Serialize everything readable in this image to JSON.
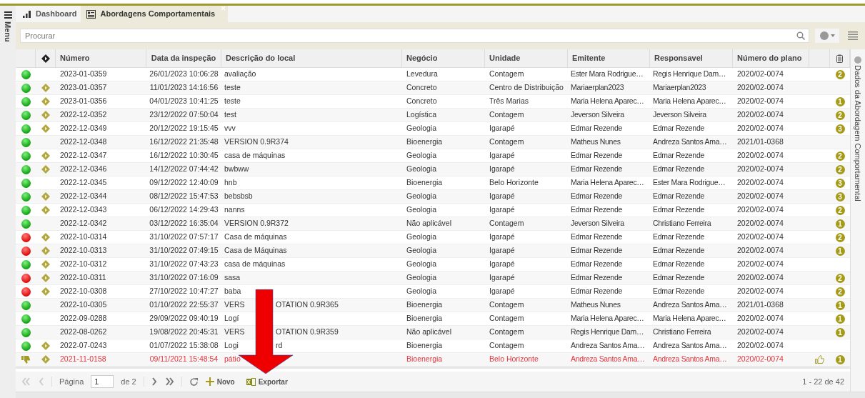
{
  "sidebar": {
    "label": "Menu"
  },
  "tabs": [
    {
      "label": "Dashboard",
      "selected": false
    },
    {
      "label": "Abordagens Comportamentais",
      "selected": true
    }
  ],
  "search": {
    "placeholder": "Procurar"
  },
  "table": {
    "columns": [
      "",
      "",
      "Número",
      "Data da inspeção",
      "Descrição do local",
      "Negócio",
      "Unidade",
      "Emitente",
      "Responsavel",
      "Número do plano",
      "",
      ""
    ],
    "rows": [
      {
        "kind": "ok",
        "flagged": false,
        "highlighted": false,
        "approved": false,
        "number": "2023-01-0359",
        "date": "26/01/2023 10:06:28",
        "description": [
          "avaliação"
        ],
        "business": "Levedura",
        "unit": "Contagem",
        "issuer": "Ester Mara Rodrigue…",
        "responsible": "Regis Henrique Dam…",
        "plan": "2020/02-0074",
        "badge": "2"
      },
      {
        "kind": "ok",
        "flagged": true,
        "highlighted": false,
        "approved": false,
        "number": "2023-01-0357",
        "date": "11/01/2023 14:16:56",
        "description": [
          "teste"
        ],
        "business": "Concreto",
        "unit": "Centro de Distribuição",
        "issuer": "Mariaerplan2023",
        "responsible": "Mariaerplan2023",
        "plan": "2020/02-0074"
      },
      {
        "kind": "ok",
        "flagged": true,
        "highlighted": false,
        "approved": false,
        "number": "2023-01-0356",
        "date": "04/01/2023 10:41:25",
        "description": [
          "teste"
        ],
        "business": "Concreto",
        "unit": "Três Marias",
        "issuer": "Maria Helena Aparec…",
        "responsible": "Maria Helena Aparec…",
        "plan": "2020/02-0074",
        "badge": "1"
      },
      {
        "kind": "ok",
        "flagged": true,
        "highlighted": false,
        "approved": false,
        "number": "2022-12-0352",
        "date": "23/12/2022 07:50:04",
        "description": [
          "test"
        ],
        "business": "Logística",
        "unit": "Contagem",
        "issuer": "Jeverson Silveira",
        "responsible": "Jeverson Silveira",
        "plan": "2020/02-0074",
        "badge": "2"
      },
      {
        "kind": "ok",
        "flagged": true,
        "highlighted": false,
        "approved": false,
        "number": "2022-12-0349",
        "date": "20/12/2022 19:15:45",
        "description": [
          "vvv"
        ],
        "business": "Geologia",
        "unit": "Igarapé",
        "issuer": "Edmar Rezende",
        "responsible": "Edmar Rezende",
        "plan": "2020/02-0074",
        "badge": "3"
      },
      {
        "kind": "ok",
        "flagged": false,
        "highlighted": false,
        "approved": false,
        "number": "2022-12-0348",
        "date": "16/12/2022 21:35:48",
        "description": [
          "VERSION 0.9R374"
        ],
        "business": "Bioenergia",
        "unit": "Contagem",
        "issuer": "Matheus Nunes",
        "responsible": "Andreza Santos Ama…",
        "plan": "2021/01-0368"
      },
      {
        "kind": "ok",
        "flagged": true,
        "highlighted": false,
        "approved": false,
        "number": "2022-12-0347",
        "date": "16/12/2022 10:30:45",
        "description": [
          "casa de máquinas"
        ],
        "business": "Geologia",
        "unit": "Igarapé",
        "issuer": "Edmar Rezende",
        "responsible": "Edmar Rezende",
        "plan": "2020/02-0074",
        "badge": "2"
      },
      {
        "kind": "ok",
        "flagged": true,
        "highlighted": false,
        "approved": false,
        "number": "2022-12-0346",
        "date": "14/12/2022 07:44:42",
        "description": [
          "bwbww"
        ],
        "business": "Geologia",
        "unit": "Igarapé",
        "issuer": "Edmar Rezende",
        "responsible": "Edmar Rezende",
        "plan": "2020/02-0074",
        "badge": "2"
      },
      {
        "kind": "ok",
        "flagged": false,
        "highlighted": false,
        "approved": false,
        "number": "2022-12-0345",
        "date": "09/12/2022 12:40:09",
        "description": [
          "hnb"
        ],
        "business": "Bioenergia",
        "unit": "Belo Horizonte",
        "issuer": "Maria Helena Aparec…",
        "responsible": "Ester Mara Rodrigue…",
        "plan": "2020/02-0074",
        "badge": "3"
      },
      {
        "kind": "ok",
        "flagged": true,
        "highlighted": false,
        "approved": false,
        "number": "2022-12-0344",
        "date": "08/12/2022 15:47:53",
        "description": [
          "bebsbsb"
        ],
        "business": "Geologia",
        "unit": "Igarapé",
        "issuer": "Edmar Rezende",
        "responsible": "Edmar Rezende",
        "plan": "2020/02-0074",
        "badge": "3"
      },
      {
        "kind": "ok",
        "flagged": true,
        "highlighted": false,
        "approved": false,
        "number": "2022-12-0343",
        "date": "06/12/2022 14:29:43",
        "description": [
          "nanns"
        ],
        "business": "Geologia",
        "unit": "Igarapé",
        "issuer": "Edmar Rezende",
        "responsible": "Edmar Rezende",
        "plan": "2020/02-0074",
        "badge": "2"
      },
      {
        "kind": "ok",
        "flagged": false,
        "highlighted": false,
        "approved": false,
        "number": "2022-12-0342",
        "date": "03/12/2022 16:35:04",
        "description": [
          "VERSION 0.9R372"
        ],
        "business": "Não aplicável",
        "unit": "Contagem",
        "issuer": "Jeverson Silveira",
        "responsible": "Christiano Ferreira",
        "plan": "2020/02-0074",
        "badge": "1"
      },
      {
        "kind": "alert",
        "flagged": true,
        "highlighted": false,
        "approved": false,
        "number": "2022-10-0314",
        "date": "31/10/2022 07:57:17",
        "description": [
          "Casa de máquinas"
        ],
        "business": "Geologia",
        "unit": "Igarapé",
        "issuer": "Edmar Rezende",
        "responsible": "Edmar Rezende",
        "plan": "2020/02-0074",
        "badge": "2"
      },
      {
        "kind": "alert",
        "flagged": true,
        "highlighted": false,
        "approved": false,
        "number": "2022-10-0313",
        "date": "31/10/2022 07:49:15",
        "description": [
          "Casa de Máquinas"
        ],
        "business": "Geologia",
        "unit": "Igarapé",
        "issuer": "Edmar Rezende",
        "responsible": "Edmar Rezende",
        "plan": "2020/02-0074",
        "badge": "1"
      },
      {
        "kind": "ok",
        "flagged": true,
        "highlighted": false,
        "approved": false,
        "number": "2022-10-0312",
        "date": "31/10/2022 07:43:23",
        "description": [
          "casa de máquinas"
        ],
        "business": "Geologia",
        "unit": "Igarapé",
        "issuer": "Edmar Rezende",
        "responsible": "Edmar Rezende",
        "plan": "2020/02-0074"
      },
      {
        "kind": "alert",
        "flagged": true,
        "highlighted": false,
        "approved": false,
        "number": "2022-10-0311",
        "date": "31/10/2022 07:16:09",
        "description": [
          "sasa"
        ],
        "business": "Geologia",
        "unit": "Igarapé",
        "issuer": "Edmar Rezende",
        "responsible": "Edmar Rezende",
        "plan": "2020/02-0074",
        "badge": "2"
      },
      {
        "kind": "alert",
        "flagged": true,
        "highlighted": false,
        "approved": false,
        "number": "2022-10-0308",
        "date": "27/10/2022 10:47:27",
        "description": [
          "baba"
        ],
        "business": "Geologia",
        "unit": "Igarapé",
        "issuer": "Edmar Rezende",
        "responsible": "Edmar Rezende",
        "plan": "2020/02-0074",
        "badge": "2"
      },
      {
        "kind": "ok",
        "flagged": false,
        "highlighted": false,
        "approved": false,
        "number": "2022-10-0305",
        "date": "01/10/2022 22:55:37",
        "description": [
          "VERS",
          "OTATION 0.9R365"
        ],
        "business": "Bioenergia",
        "unit": "Contagem",
        "issuer": "Matheus Nunes",
        "responsible": "Andreza Santos Ama…",
        "plan": "2021/01-0368",
        "badge": "1"
      },
      {
        "kind": "ok",
        "flagged": false,
        "highlighted": false,
        "approved": false,
        "number": "2022-09-0288",
        "date": "29/09/2022 09:40:19",
        "description": [
          "Logí"
        ],
        "business": "Bioenergia",
        "unit": "Contagem",
        "issuer": "Maria Helena Aparec…",
        "responsible": "Maria Helena Aparec…",
        "plan": "2020/02-0074",
        "badge": "1"
      },
      {
        "kind": "ok",
        "flagged": false,
        "highlighted": false,
        "approved": false,
        "number": "2022-08-0262",
        "date": "19/08/2022 20:45:31",
        "description": [
          "VERS",
          "OTATION 0.9R359"
        ],
        "business": "Não aplicável",
        "unit": "Contagem",
        "issuer": "Regis Henrique Dam…",
        "responsible": "Christiano Ferreira",
        "plan": "2020/02-0074",
        "badge": "1"
      },
      {
        "kind": "ok",
        "flagged": true,
        "highlighted": false,
        "approved": false,
        "number": "2022-07-0243",
        "date": "01/07/2022 15:38:08",
        "description": [
          "Logi",
          "rd"
        ],
        "business": "Bioenergia",
        "unit": "Contagem",
        "issuer": "Andreza Santos Ama…",
        "responsible": "Andreza Santos Ama…",
        "plan": "2020/02-0074"
      },
      {
        "kind": "disapproved",
        "flagged": true,
        "highlighted": true,
        "approved": true,
        "number": "2021-11-0158",
        "date": "09/11/2021 15:48:54",
        "description": [
          "pátio"
        ],
        "business": "Bioenergia",
        "unit": "Belo Horizonte",
        "issuer": "Andreza Santos Ama…",
        "responsible": "Andreza Santos Ama…",
        "plan": "2020/02-0074",
        "badge": "1"
      }
    ]
  },
  "pager": {
    "page_label": "Página",
    "page": "1",
    "of_label": "de 2",
    "new_button": "Novo",
    "export_button": "Exportar",
    "summary": "1 - 22 de 42"
  },
  "side_panel": {
    "title": "Dados da Abordagem Comportamental"
  }
}
